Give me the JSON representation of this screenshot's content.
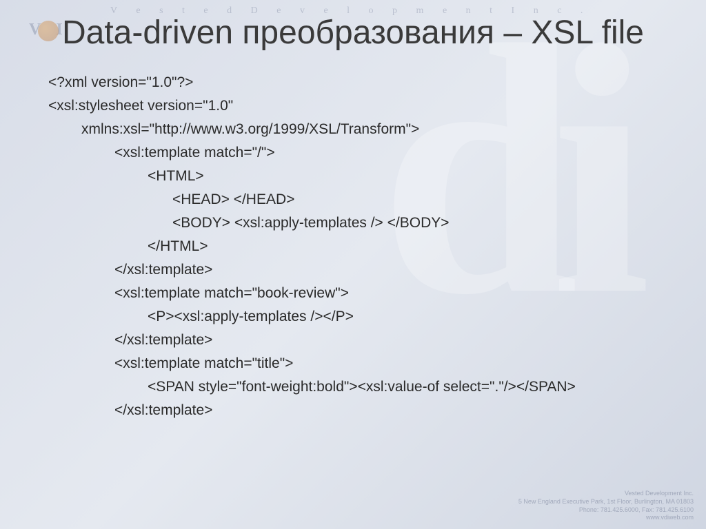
{
  "header": {
    "company_watermark": "V e s t e d   D e v e l o p m e n t   I n c .",
    "logo_left": "V",
    "logo_right": "I"
  },
  "title": "Data-driven преобразования – XSL file",
  "code": {
    "line1": "<?xml version=\"1.0\"?>",
    "line2": "<xsl:stylesheet version=\"1.0\"",
    "line3": "xmlns:xsl=\"http://www.w3.org/1999/XSL/Transform\">",
    "line4": "<xsl:template match=\"/\">",
    "line5": "<HTML>",
    "line6": "<HEAD> </HEAD>",
    "line7": "<BODY> <xsl:apply-templates /> </BODY>",
    "line8": "</HTML>",
    "line9": "</xsl:template>",
    "line10": "<xsl:template match=\"book-review\">",
    "line11": "<P><xsl:apply-templates /></P>",
    "line12": "</xsl:template>",
    "line13": "<xsl:template match=\"title\">",
    "line14": "<SPAN style=\"font-weight:bold\"><xsl:value-of select=\".\"/></SPAN>",
    "line15": "</xsl:template>"
  },
  "footer": {
    "line1": "Vested Development Inc.",
    "line2": "5 New England Executive Park, 1st Floor, Burlington, MA 01803",
    "line3": "Phone: 781.425.6000, Fax: 781.425.6100",
    "line4": "www.vdiweb.com"
  }
}
